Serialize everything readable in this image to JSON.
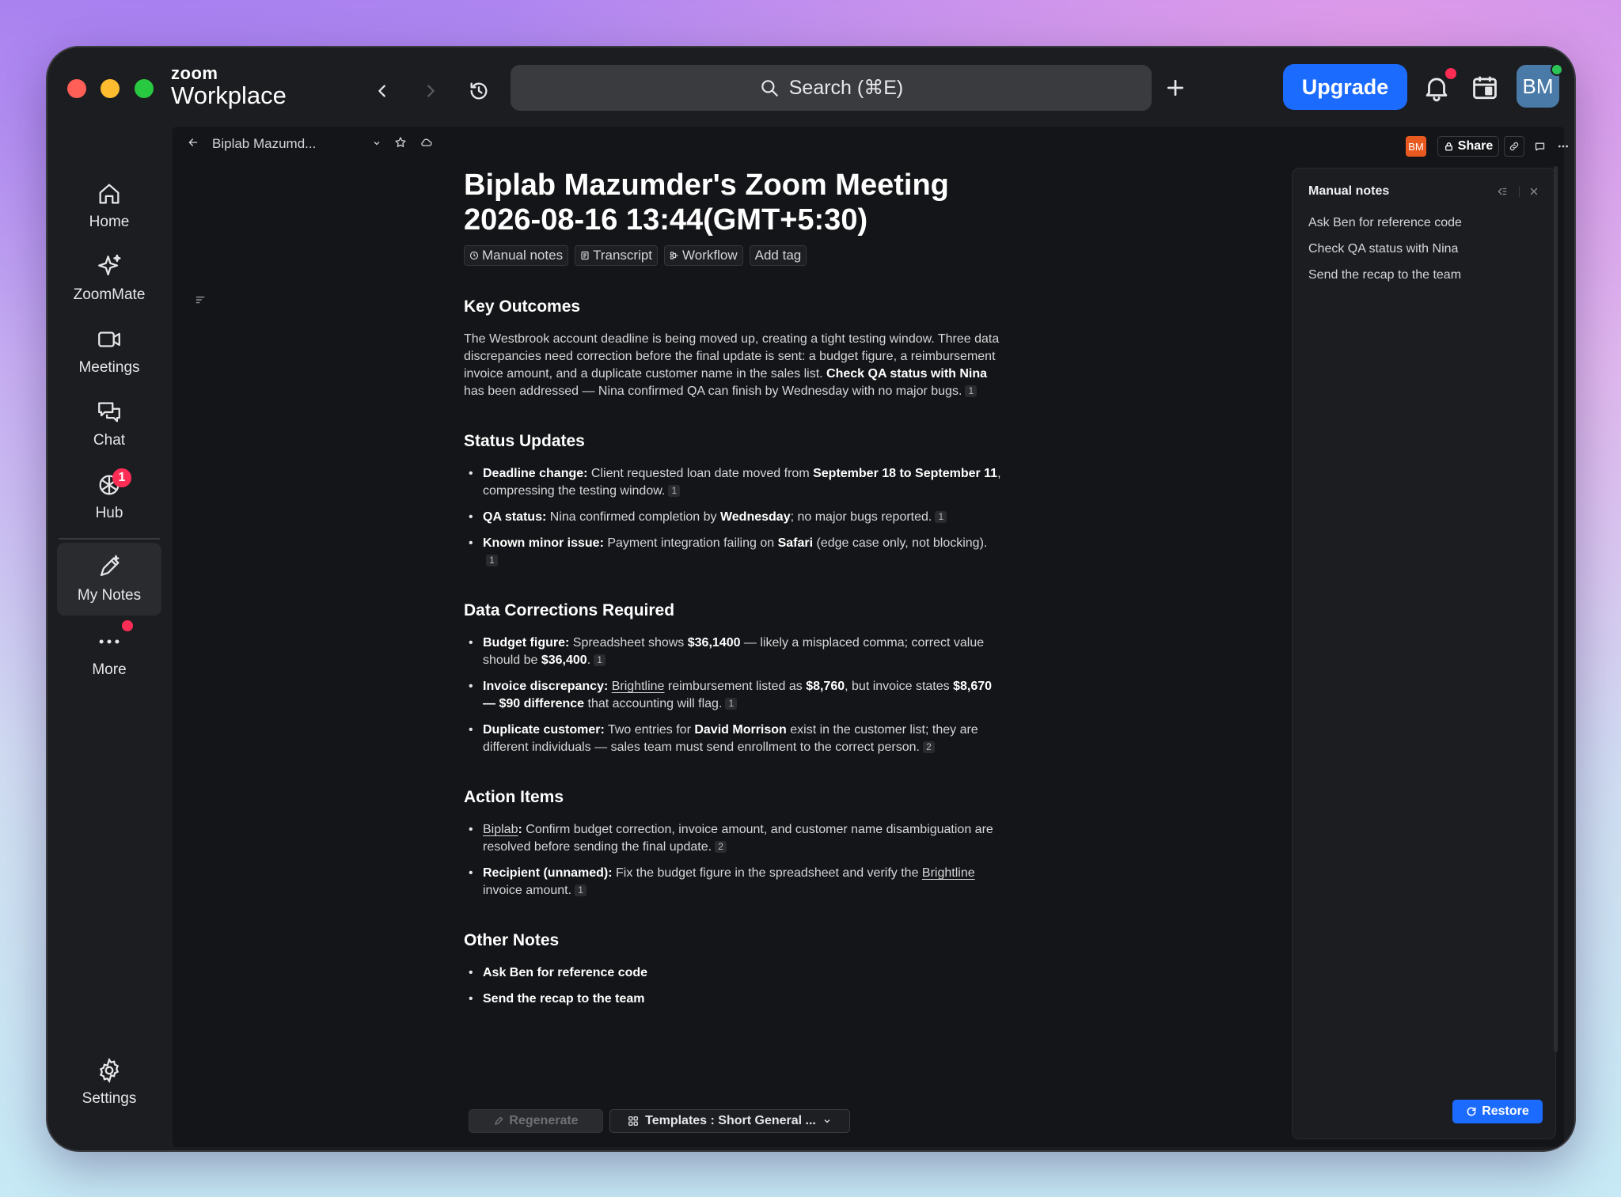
{
  "app": {
    "brand_small": "zoom",
    "brand_big": "Workplace",
    "search_label": "Search (⌘E)",
    "upgrade_label": "Upgrade",
    "avatar_initials": "BM"
  },
  "sidebar": {
    "items": [
      {
        "label": "Home",
        "icon": "home-icon"
      },
      {
        "label": "ZoomMate",
        "icon": "sparkle-icon"
      },
      {
        "label": "Meetings",
        "icon": "video-icon"
      },
      {
        "label": "Chat",
        "icon": "chat-icon"
      },
      {
        "label": "Hub",
        "icon": "hub-icon",
        "badge": "1"
      },
      {
        "label": "My Notes",
        "icon": "notes-pen-icon",
        "active": true
      },
      {
        "label": "More",
        "icon": "more-icon"
      },
      {
        "label": "Settings",
        "icon": "gear-icon"
      }
    ]
  },
  "breadcrumb": {
    "title": "Biplab Mazumd..."
  },
  "toolbar": {
    "owner_initials": "BM",
    "share_label": "Share"
  },
  "doc": {
    "title_line1": "Biplab Mazumder's Zoom Meeting",
    "title_line2": "2026-08-16 13:44(GMT+5:30)",
    "tags": [
      "Manual notes",
      "Transcript",
      "Workflow",
      "Add tag"
    ],
    "sections": {
      "key_outcomes": {
        "heading": "Key Outcomes",
        "text_a": "The Westbrook account deadline is being moved up, creating a tight testing window. Three data discrepancies need correction before the final update is sent: a budget figure, a reimbursement invoice amount, and a duplicate customer name in the sales list. ",
        "bold": "Check QA status with Nina",
        "text_b": " has been addressed — Nina confirmed QA can finish by Wednesday with no major bugs.",
        "ref": "1"
      },
      "status_updates": {
        "heading": "Status Updates",
        "items": [
          {
            "a": "Deadline change:",
            "b": " Client requested loan date moved from ",
            "c": "September 18 to September 11",
            "d": ", compressing the testing window.",
            "ref": "1"
          },
          {
            "a": "QA status:",
            "b": " Nina confirmed completion by ",
            "c": "Wednesday",
            "d": "; no major bugs reported.",
            "ref": "1"
          },
          {
            "a": "Known minor issue:",
            "b": " Payment integration failing on ",
            "c": "Safari",
            "d": " (edge case only, not blocking).",
            "ref": "1"
          }
        ]
      },
      "data_corrections": {
        "heading": "Data Corrections Required",
        "items": [
          {
            "a": "Budget figure:",
            "b": " Spreadsheet shows ",
            "c": "$36,1400",
            "d": " — likely a misplaced comma; correct value should be ",
            "e": "$36,400",
            "f": ".",
            "ref": "1"
          },
          {
            "a": "Invoice discrepancy:",
            "link": "Brightline",
            "b": " reimbursement listed as ",
            "c": "$8,760",
            "d": ", but invoice states ",
            "e": "$8,670 — $90 difference",
            "f": " that accounting will flag.",
            "ref": "1"
          },
          {
            "a": "Duplicate customer:",
            "b": " Two entries for ",
            "c": "David Morrison",
            "d": " exist in the customer list; they are different individuals — sales team must send enrollment to the correct person.",
            "ref": "2"
          }
        ]
      },
      "action_items": {
        "heading": "Action Items",
        "items": [
          {
            "link": "Biplab",
            "a": ":",
            "b": " Confirm budget correction, invoice amount, and customer name disambiguation are resolved before sending the final update.",
            "ref": "2"
          },
          {
            "a": "Recipient (unnamed):",
            "b": " Fix the budget figure in the spreadsheet and verify the ",
            "link": "Brightline",
            "c": " invoice amount.",
            "ref": "1"
          }
        ]
      },
      "other_notes": {
        "heading": "Other Notes",
        "items": [
          "Ask Ben for reference code",
          "Send the recap to the team"
        ]
      }
    }
  },
  "bottom": {
    "regenerate_label": "Regenerate",
    "templates_label": "Templates : Short General ..."
  },
  "manual_panel": {
    "title": "Manual notes",
    "items": [
      "Ask Ben for reference code",
      "Check QA status with Nina",
      "Send the recap to the team"
    ],
    "restore_label": "Restore"
  },
  "colors": {
    "accent": "#1c6bff",
    "badge": "#ff2d55",
    "window_bg": "#1c1d20",
    "content_bg": "#141518"
  }
}
